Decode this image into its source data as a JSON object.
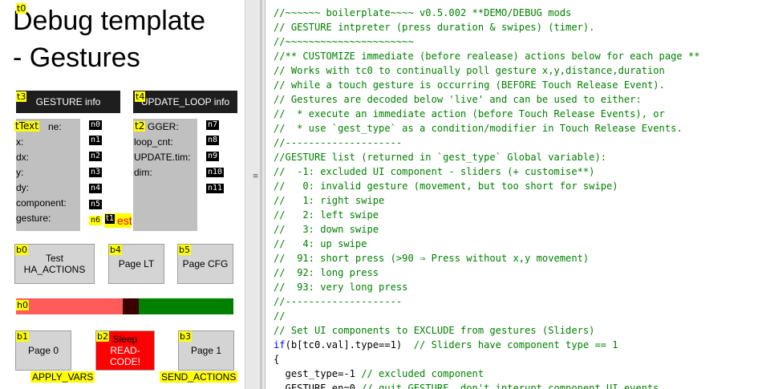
{
  "canvas": {
    "title_tag": "t0",
    "title_line1": "Debug template",
    "title_line2": "- Gestures",
    "gesture_header": {
      "tag": "t3",
      "label": "GESTURE info"
    },
    "loop_header": {
      "tag": "t4",
      "label": "UPDATE_LOOP info"
    },
    "gesture_labels": [
      "x:",
      "dx:",
      "y:",
      "dy:",
      "component:",
      "gesture:"
    ],
    "gesture_label_first": "ne:",
    "gesture_label_first_tag": "tText",
    "gesture_nums": [
      "n0",
      "n1",
      "n2",
      "n3",
      "n4",
      "n5"
    ],
    "gesture_num_last": "n6",
    "t1_tag": "t1",
    "t1_text": "est",
    "loop_labels": [
      "GGER:",
      "loop_cnt:",
      "UPDATE.tim:",
      "dim:"
    ],
    "loop_first_tag": "t2",
    "loop_nums": [
      "n7",
      "n8",
      "n9",
      "n10",
      "n11"
    ],
    "buttons_row1": [
      {
        "tag": "b0",
        "label": "Test HA_ACTIONS"
      },
      {
        "tag": "b4",
        "label": "Page LT"
      },
      {
        "tag": "b5",
        "label": "Page CFG"
      }
    ],
    "slider_tag": "h0",
    "slider_value_pct": 53,
    "buttons_row2": [
      {
        "tag": "b1",
        "label": "Page 0"
      },
      {
        "tag": "b2",
        "label_line1": "Sleep",
        "label_line2": "READ-CODE!"
      },
      {
        "tag": "b3",
        "label": "Page 1"
      }
    ],
    "caption_left": "APPLY_VARS",
    "caption_right": "SEND_ACTIONS"
  },
  "splitter": {
    "grip_symbol": "≡"
  },
  "editor": {
    "lines": [
      [
        {
          "c": "cm",
          "t": "//~~~~~~ boilerplate~~~~ v0.5.002 **DEMO/DEBUG mods"
        }
      ],
      [
        {
          "c": "cm",
          "t": "// GESTURE intpreter (press duration & swipes) (timer)."
        }
      ],
      [
        {
          "c": "cm",
          "t": "//~~~~~~~~~~~~~~~~~~~~~~"
        }
      ],
      [
        {
          "c": "cm",
          "t": "//** CUSTOMIZE immediate (before realease) actions below for each page **"
        }
      ],
      [
        {
          "c": "cm",
          "t": "// Works with tc0 to continually poll gesture x,y,distance,duration"
        }
      ],
      [
        {
          "c": "cm",
          "t": "// while a touch gesture is occurring (BEFORE Touch Release Event)."
        }
      ],
      [
        {
          "c": "cm",
          "t": "// Gestures are decoded below 'live' and can be used to either:"
        }
      ],
      [
        {
          "c": "cm",
          "t": "//  * execute an immediate action (before Touch Release Events), or"
        }
      ],
      [
        {
          "c": "cm",
          "t": "//  * use `gest_type` as a condition/modifier in Touch Release Events."
        }
      ],
      [
        {
          "c": "cm",
          "t": "//--------------------"
        }
      ],
      [
        {
          "c": "cm",
          "t": "//GESTURE list (returned in `gest_type` Global variable):"
        }
      ],
      [
        {
          "c": "cm",
          "t": "//  -1: excluded UI component - sliders (+ customise**)"
        }
      ],
      [
        {
          "c": "cm",
          "t": "//   0: invalid gesture (movement, but too short for swipe)"
        }
      ],
      [
        {
          "c": "cm",
          "t": "//   1: right swipe"
        }
      ],
      [
        {
          "c": "cm",
          "t": "//   2: left swipe"
        }
      ],
      [
        {
          "c": "cm",
          "t": "//   3: down swipe"
        }
      ],
      [
        {
          "c": "cm",
          "t": "//   4: up swipe"
        }
      ],
      [
        {
          "c": "cm",
          "t": "//  91: short press (>90 ⇒ Press without x,y movement)"
        }
      ],
      [
        {
          "c": "cm",
          "t": "//  92: long press"
        }
      ],
      [
        {
          "c": "cm",
          "t": "//  93: very long press"
        }
      ],
      [
        {
          "c": "cm",
          "t": "//--------------------"
        }
      ],
      [
        {
          "c": "cm",
          "t": "//"
        }
      ],
      [
        {
          "c": "cm",
          "t": "// Set UI components to EXCLUDE from gestures (Sliders)"
        }
      ],
      [
        {
          "c": "kw",
          "t": "if"
        },
        {
          "c": "tx",
          "t": "(b[tc0.val].type==1)  "
        },
        {
          "c": "cm",
          "t": "// Sliders have component type == 1"
        }
      ],
      [
        {
          "c": "tx",
          "t": "{"
        }
      ],
      [
        {
          "c": "tx",
          "t": "  gest_type=-1 "
        },
        {
          "c": "cm",
          "t": "// excluded component"
        }
      ],
      [
        {
          "c": "tx",
          "t": "  GESTURE.en=0 "
        },
        {
          "c": "cm",
          "t": "// quit GESTURE, don't interupt component UI events"
        }
      ]
    ]
  },
  "colors": {
    "slider_fill": "#ff5b5b",
    "slider_thumb": "#3a0000",
    "slider_track": "#008000",
    "comment": "#008000",
    "keyword": "#0000ff",
    "tag_yellow": "#ffff00"
  }
}
